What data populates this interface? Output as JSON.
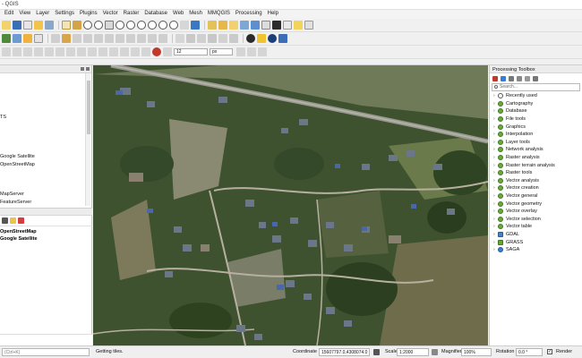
{
  "window": {
    "title": "- QGIS"
  },
  "menubar": [
    "Edit",
    "View",
    "Layer",
    "Settings",
    "Plugins",
    "Vector",
    "Raster",
    "Database",
    "Web",
    "Mesh",
    "MMQGIS",
    "Processing",
    "Help"
  ],
  "toolbar3": {
    "scale_value": "12",
    "unit_value": "px"
  },
  "browser": {
    "items": [
      "TS",
      "Google Satellite",
      "OpenStreetMap",
      "MapServer",
      "FeatureServer"
    ]
  },
  "layers": {
    "items": [
      "OpenStreetMap",
      "Google Satellite"
    ]
  },
  "processing": {
    "title": "Processing Toolbox",
    "search_placeholder": "Search...",
    "items": [
      {
        "label": "Recently used",
        "icon": "clock-icon"
      },
      {
        "label": "Cartography",
        "icon": "qgis-icon"
      },
      {
        "label": "Database",
        "icon": "qgis-icon"
      },
      {
        "label": "File tools",
        "icon": "qgis-icon"
      },
      {
        "label": "Graphics",
        "icon": "qgis-icon"
      },
      {
        "label": "Interpolation",
        "icon": "qgis-icon"
      },
      {
        "label": "Layer tools",
        "icon": "qgis-icon"
      },
      {
        "label": "Network analysis",
        "icon": "qgis-icon"
      },
      {
        "label": "Raster analysis",
        "icon": "qgis-icon"
      },
      {
        "label": "Raster terrain analysis",
        "icon": "qgis-icon"
      },
      {
        "label": "Raster tools",
        "icon": "qgis-icon"
      },
      {
        "label": "Vector analysis",
        "icon": "qgis-icon"
      },
      {
        "label": "Vector creation",
        "icon": "qgis-icon"
      },
      {
        "label": "Vector general",
        "icon": "qgis-icon"
      },
      {
        "label": "Vector geometry",
        "icon": "qgis-icon"
      },
      {
        "label": "Vector overlay",
        "icon": "qgis-icon"
      },
      {
        "label": "Vector selection",
        "icon": "qgis-icon"
      },
      {
        "label": "Vector table",
        "icon": "qgis-icon"
      },
      {
        "label": "GDAL",
        "icon": "gdal-icon"
      },
      {
        "label": "GRASS",
        "icon": "grass-icon"
      },
      {
        "label": "SAGA",
        "icon": "saga-icon"
      }
    ]
  },
  "statusbar": {
    "search_placeholder": "(Ctrl+K)",
    "message": "Getting tiles.",
    "coordinate_label": "Coordinate",
    "coordinate_value": "15607797.0,4308074.0",
    "scale_label": "Scale",
    "scale_value": "1:2000",
    "magnifier_label": "Magnifier",
    "magnifier_value": "100%",
    "rotation_label": "Rotation",
    "rotation_value": "0.0 °",
    "render_label": "Render"
  },
  "colors": {
    "accent_green": "#6aa93a",
    "map_vegetation": "#3f5a2c"
  }
}
